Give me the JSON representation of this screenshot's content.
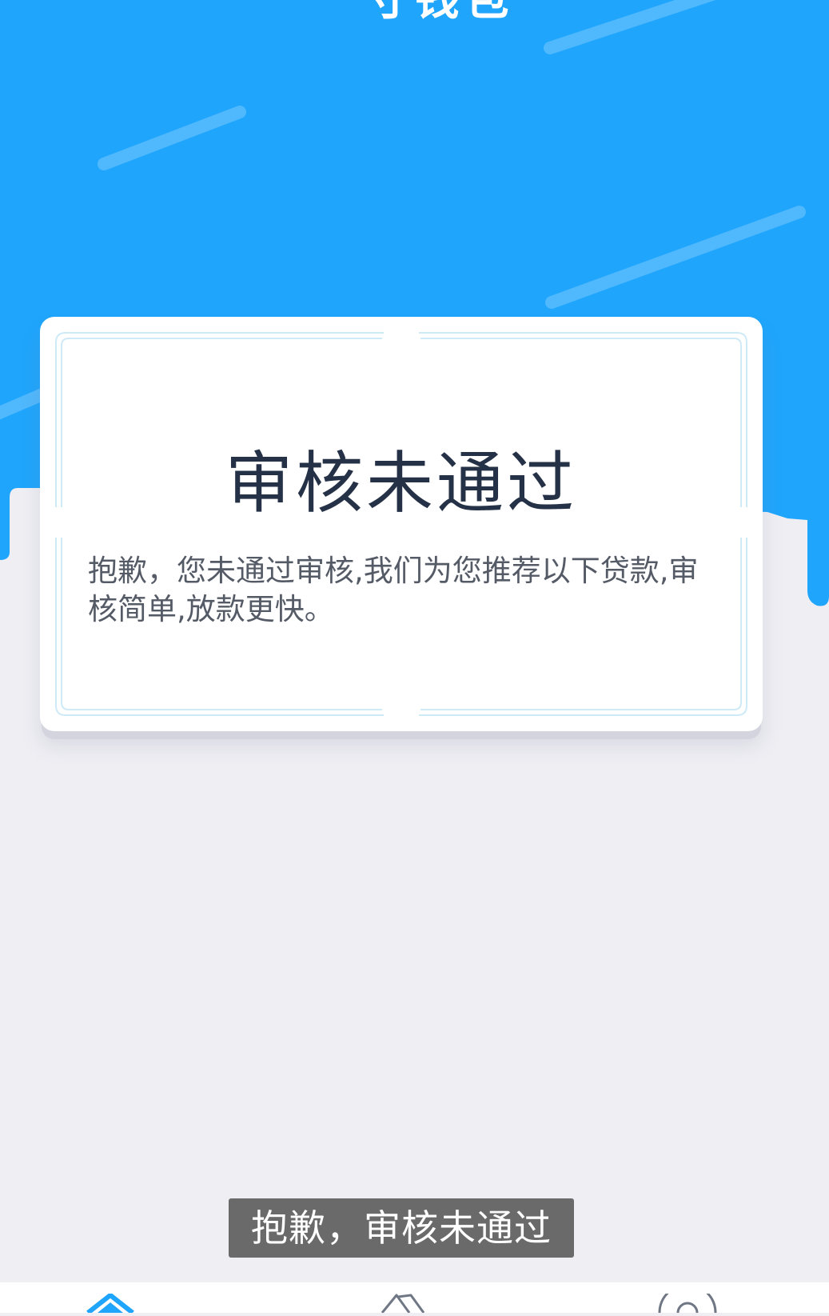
{
  "header": {
    "app_title": "一寸钱包"
  },
  "result_card": {
    "title": "审核未通过",
    "message": "抱歉，您未通过审核,我们为您推荐以下贷款,审核简单,放款更快。"
  },
  "toast": {
    "text": "抱歉，审核未通过"
  },
  "tabbar": {
    "tabs": [
      {
        "icon": "home-icon",
        "active": true
      },
      {
        "icon": "loan-icon",
        "active": false
      },
      {
        "icon": "user-icon",
        "active": false
      }
    ]
  },
  "colors": {
    "brand_blue": "#1fa5fc",
    "background": "#eeeef3",
    "title_text": "#253146",
    "body_text": "#555b66",
    "toast_bg": "#6a6a6a"
  }
}
